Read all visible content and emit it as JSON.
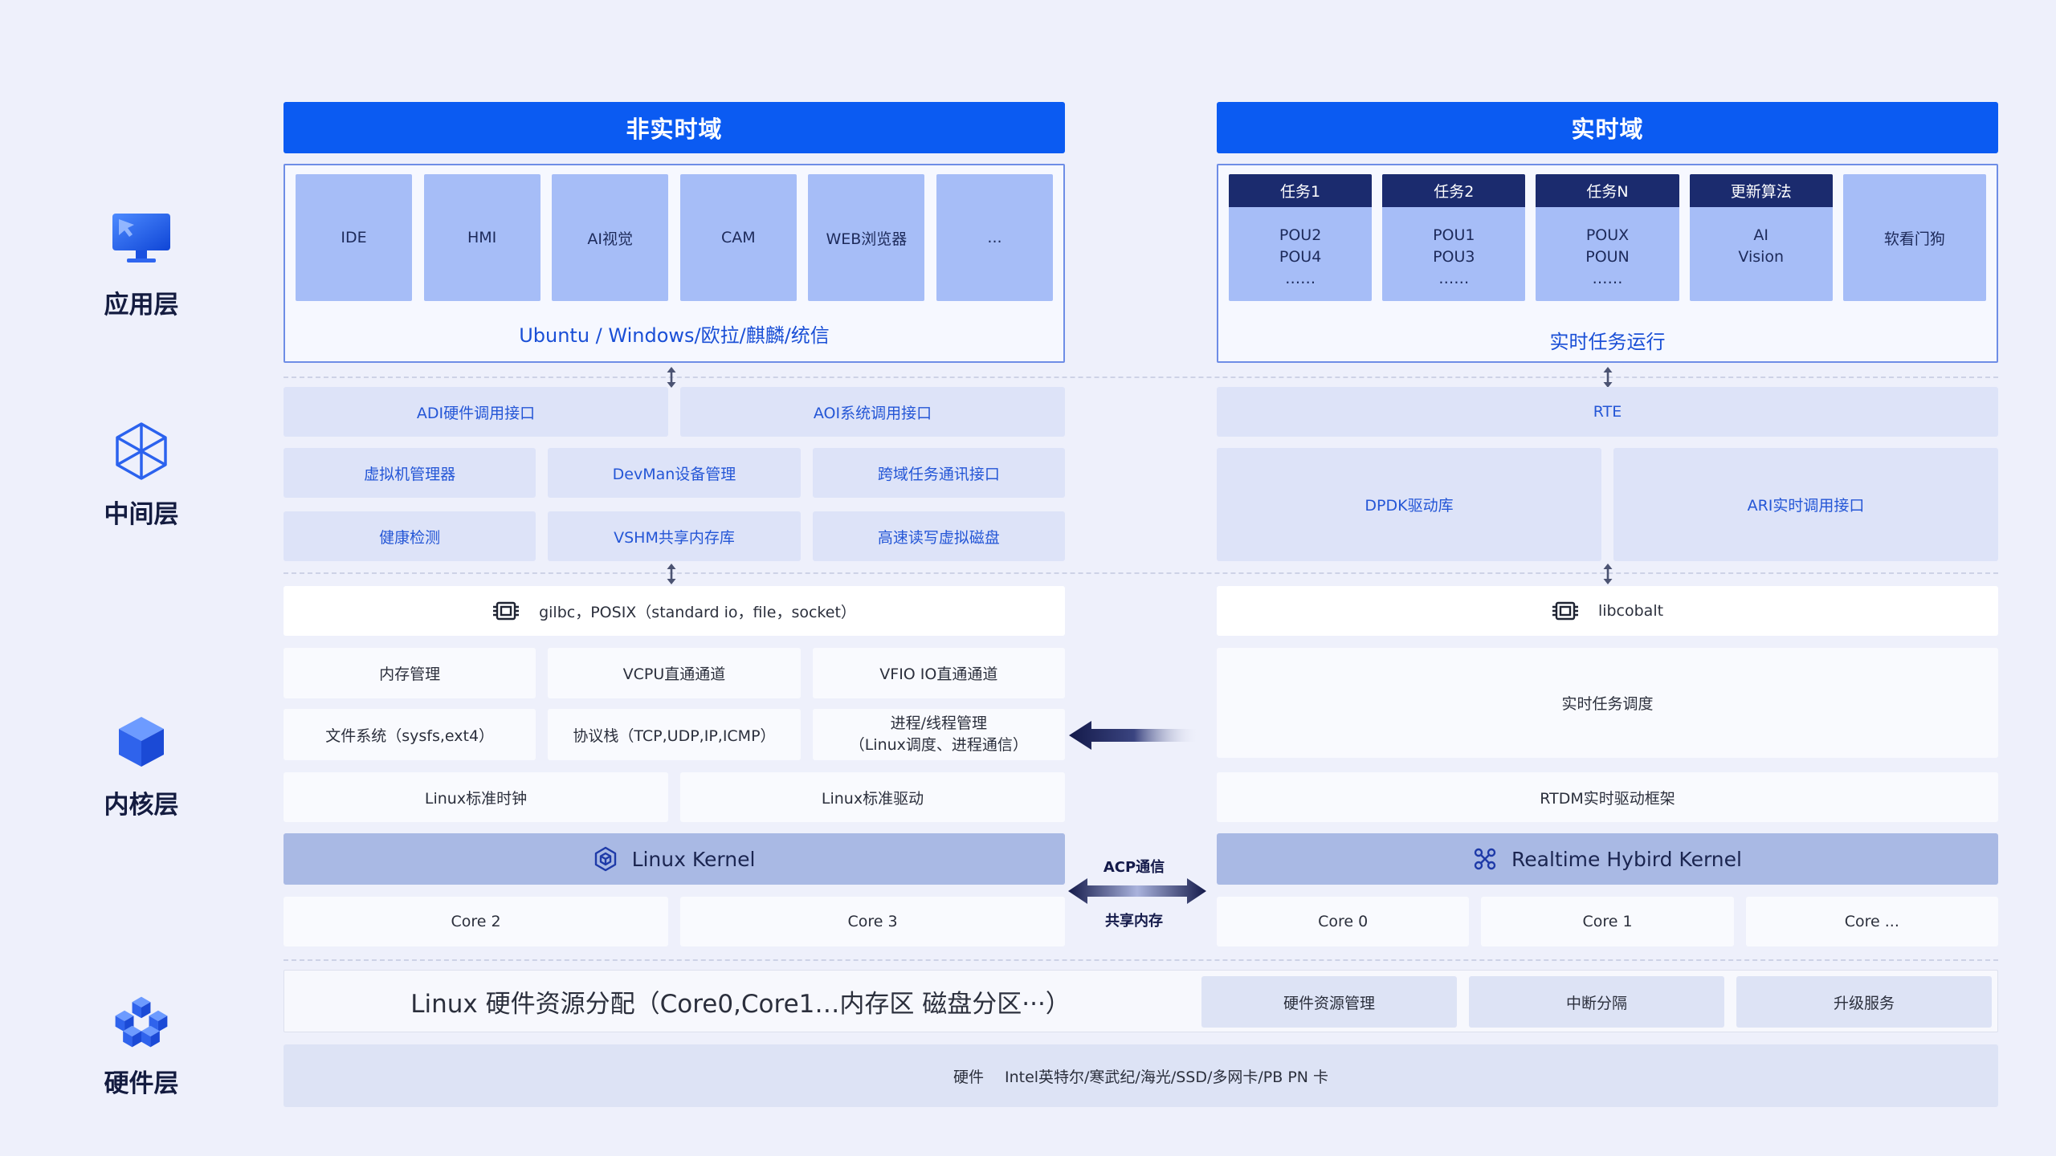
{
  "layers": [
    {
      "label": "应用层",
      "icon": "monitor-icon"
    },
    {
      "label": "中间层",
      "icon": "cube-wireframe-icon"
    },
    {
      "label": "内核层",
      "icon": "cube-icon"
    },
    {
      "label": "硬件层",
      "icon": "cubes-cluster-icon"
    }
  ],
  "non_realtime": {
    "title": "非实时域",
    "apps": [
      "IDE",
      "HMI",
      "AI视觉",
      "CAM",
      "WEB浏览器",
      "..."
    ],
    "os": "Ubuntu / Windows/欧拉/麒麟/统信",
    "middleware": {
      "row1": [
        "ADI硬件调用接口",
        "AOI系统调用接口"
      ],
      "row2": [
        "虚拟机管理器",
        "DevMan设备管理",
        "跨域任务通讯接口"
      ],
      "row3": [
        "健康检测",
        "VSHM共享内存库",
        "高速读写虚拟磁盘"
      ]
    },
    "libc": "gilbc，POSIX（standard io，file，socket）",
    "kernel_modules": {
      "row1": [
        "内存管理",
        "VCPU直通通道",
        "VFIO IO直通通道"
      ],
      "row2": [
        "文件系统（sysfs,ext4）",
        "协议栈（TCP,UDP,IP,ICMP）"
      ],
      "process_mgmt": {
        "title": "进程/线程管理",
        "detail": "（Linux调度、进程通信）"
      },
      "row3": [
        "Linux标准时钟",
        "Linux标准驱动"
      ]
    },
    "kernel": "Linux Kernel",
    "cores": [
      "Core 2",
      "Core 3"
    ]
  },
  "realtime": {
    "title": "实时域",
    "tasks": [
      {
        "header": "任务1",
        "lines": [
          "POU2",
          "POU4",
          "……"
        ]
      },
      {
        "header": "任务2",
        "lines": [
          "POU1",
          "POU3",
          "……"
        ]
      },
      {
        "header": "任务N",
        "lines": [
          "POUX",
          "POUN",
          "……"
        ]
      },
      {
        "header": "更新算法",
        "lines": [
          "AI",
          "Vision"
        ]
      }
    ],
    "watchdog": "软看门狗",
    "run_label": "实时任务运行",
    "rte": "RTE",
    "drivers": [
      "DPDK驱动库",
      "ARI实时调用接口"
    ],
    "libc": "libcobalt",
    "scheduler": "实时任务调度",
    "rtdm": "RTDM实时驱动框架",
    "kernel": "Realtime Hybird Kernel",
    "cores": [
      "Core 0",
      "Core 1",
      "Core ..."
    ]
  },
  "communication": {
    "acp": "ACP通信",
    "shm": "共享内存"
  },
  "hardware": {
    "allocation": "Linux  硬件资源分配（Core0,Core1…内存区 磁盘分区···）",
    "services": [
      "硬件资源管理",
      "中断分隔",
      "升级服务"
    ],
    "label": "硬件",
    "vendors": "Intel英特尔/寒武纪/海光/SSD/多网卡/PB PN 卡"
  },
  "colors": {
    "background": "#eef0fb",
    "accent": "#0b5bf2",
    "task_header": "#1b2b6e",
    "app_tile": "#a6bdf7",
    "middleware_tile": "#dde3f8",
    "kernel_bar": "#a9b9e4",
    "arrow": "#141a4a"
  }
}
